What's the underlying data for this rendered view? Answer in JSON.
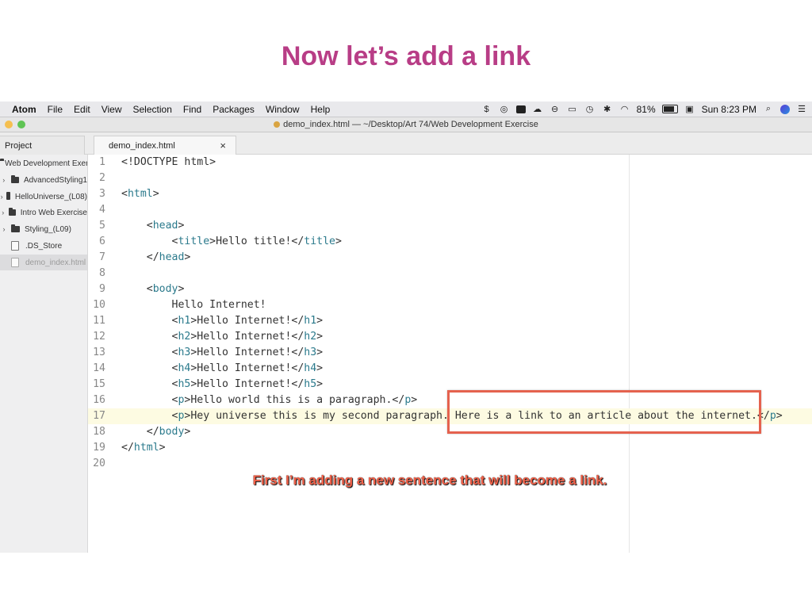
{
  "slide": {
    "title": "Now let’s add a link",
    "caption": "First I’m adding a new sentence that will become a link."
  },
  "menubar": {
    "app_name": "Atom",
    "items": [
      "File",
      "Edit",
      "View",
      "Selection",
      "Find",
      "Packages",
      "Window",
      "Help"
    ],
    "battery": "81%",
    "clock": "Sun 8:23 PM"
  },
  "window": {
    "title": "demo_index.html — ~/Desktop/Art 74/Web Development Exercise"
  },
  "tabs": {
    "project": "Project",
    "file": "demo_index.html",
    "close": "×"
  },
  "sidebar": {
    "root": "Web Development Exercise",
    "items": [
      {
        "label": "AdvancedStyling1",
        "type": "folder"
      },
      {
        "label": "HelloUniverse_(L08)",
        "type": "folder"
      },
      {
        "label": "Intro Web Exercise",
        "type": "folder"
      },
      {
        "label": "Styling_(L09)",
        "type": "folder"
      },
      {
        "label": ".DS_Store",
        "type": "file"
      },
      {
        "label": "demo_index.html",
        "type": "file",
        "selected": true
      }
    ]
  },
  "editor": {
    "current_line": 17,
    "lines": [
      "<!DOCTYPE html>",
      "",
      "<html>",
      "",
      "    <head>",
      "        <title>Hello title!</title>",
      "    </head>",
      "",
      "    <body>",
      "        Hello Internet!",
      "        <h1>Hello Internet!</h1>",
      "        <h2>Hello Internet!</h2>",
      "        <h3>Hello Internet!</h3>",
      "        <h4>Hello Internet!</h4>",
      "        <h5>Hello Internet!</h5>",
      "        <p>Hello world this is a paragraph.</p>",
      "        <p>Hey universe this is my second paragraph. Here is a link to an article about the internet.</p>",
      "    </body>",
      "</html>",
      ""
    ]
  }
}
